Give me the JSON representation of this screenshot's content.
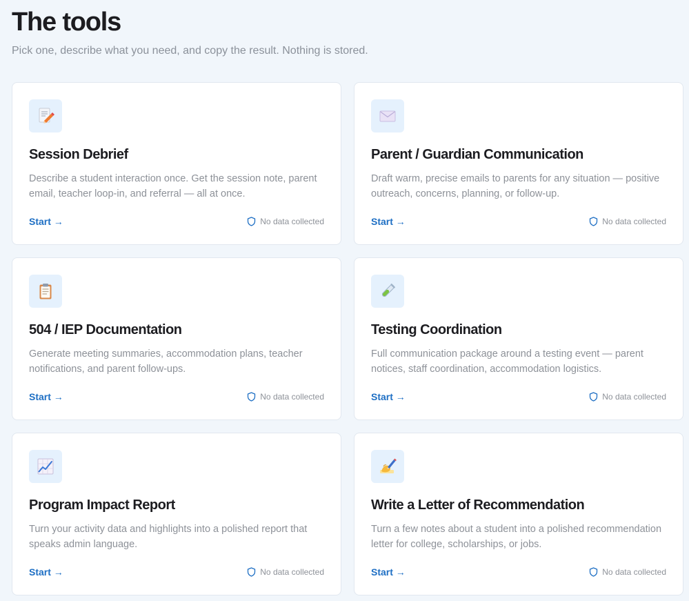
{
  "header": {
    "title": "The tools",
    "subtitle": "Pick one, describe what you need, and copy the result. Nothing is stored."
  },
  "cards": [
    {
      "icon": "memo-pencil-icon",
      "title": "Session Debrief",
      "description": "Describe a student interaction once. Get the session note, parent email, teacher loop-in, and referral — all at once.",
      "start_label": "Start →",
      "privacy_label": "No data collected"
    },
    {
      "icon": "envelope-icon",
      "title": "Parent / Guardian Communication",
      "description": "Draft warm, precise emails to parents for any situation — positive outreach, concerns, planning, or follow-up.",
      "start_label": "Start →",
      "privacy_label": "No data collected"
    },
    {
      "icon": "clipboard-icon",
      "title": "504 / IEP Documentation",
      "description": "Generate meeting summaries, accommodation plans, teacher notifications, and parent follow-ups.",
      "start_label": "Start →",
      "privacy_label": "No data collected"
    },
    {
      "icon": "test-tube-icon",
      "title": "Testing Coordination",
      "description": "Full communication package around a testing event — parent notices, staff coordination, accommodation logistics.",
      "start_label": "Start →",
      "privacy_label": "No data collected"
    },
    {
      "icon": "chart-increasing-icon",
      "title": "Program Impact Report",
      "description": "Turn your activity data and highlights into a polished report that speaks admin language.",
      "start_label": "Start →",
      "privacy_label": "No data collected"
    },
    {
      "icon": "writing-hand-icon",
      "title": "Write a Letter of Recommendation",
      "description": "Turn a few notes about a student into a polished recommendation letter for college, scholarships, or jobs.",
      "start_label": "Start →",
      "privacy_label": "No data collected"
    }
  ],
  "colors": {
    "background": "#f1f6fb",
    "card": "#ffffff",
    "icon_tile": "#e5f1fd",
    "accent": "#1e6fc4",
    "muted_text": "#8d9198"
  }
}
